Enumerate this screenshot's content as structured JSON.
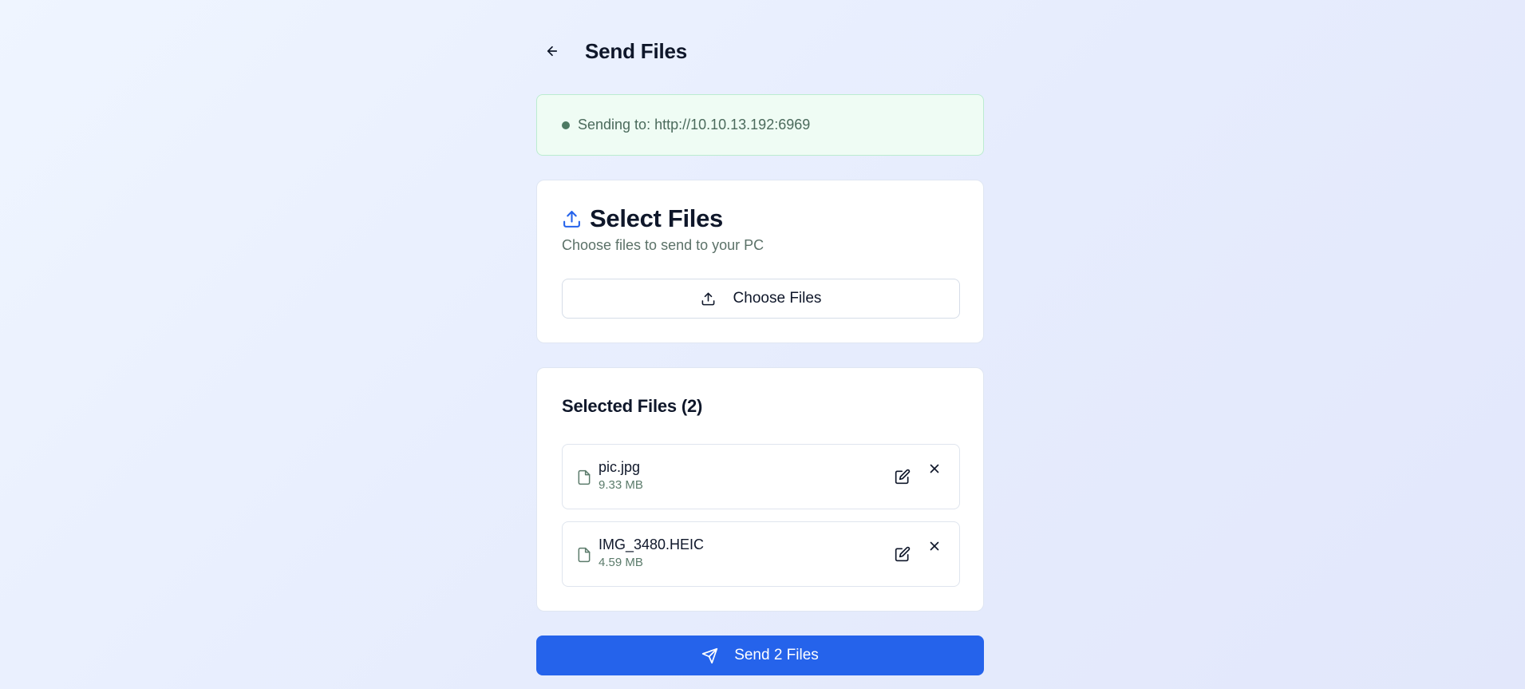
{
  "header": {
    "title": "Send Files",
    "back_icon": "arrow-left-icon"
  },
  "status": {
    "text": "Sending to: http://10.10.13.192:6969",
    "dot_color": "#4d7a63"
  },
  "select_card": {
    "title": "Select Files",
    "description": "Choose files to send to your PC",
    "title_icon": "upload-icon",
    "choose_button_label": "Choose Files",
    "accent_color": "#2563eb"
  },
  "selected_card": {
    "title": "Selected Files (2)",
    "files": [
      {
        "name": "pic.jpg",
        "size": "9.33 MB"
      },
      {
        "name": "IMG_3480.HEIC",
        "size": "4.59 MB"
      }
    ]
  },
  "send_button": {
    "label": "Send 2 Files",
    "icon": "send-icon",
    "color": "#2563eb"
  }
}
